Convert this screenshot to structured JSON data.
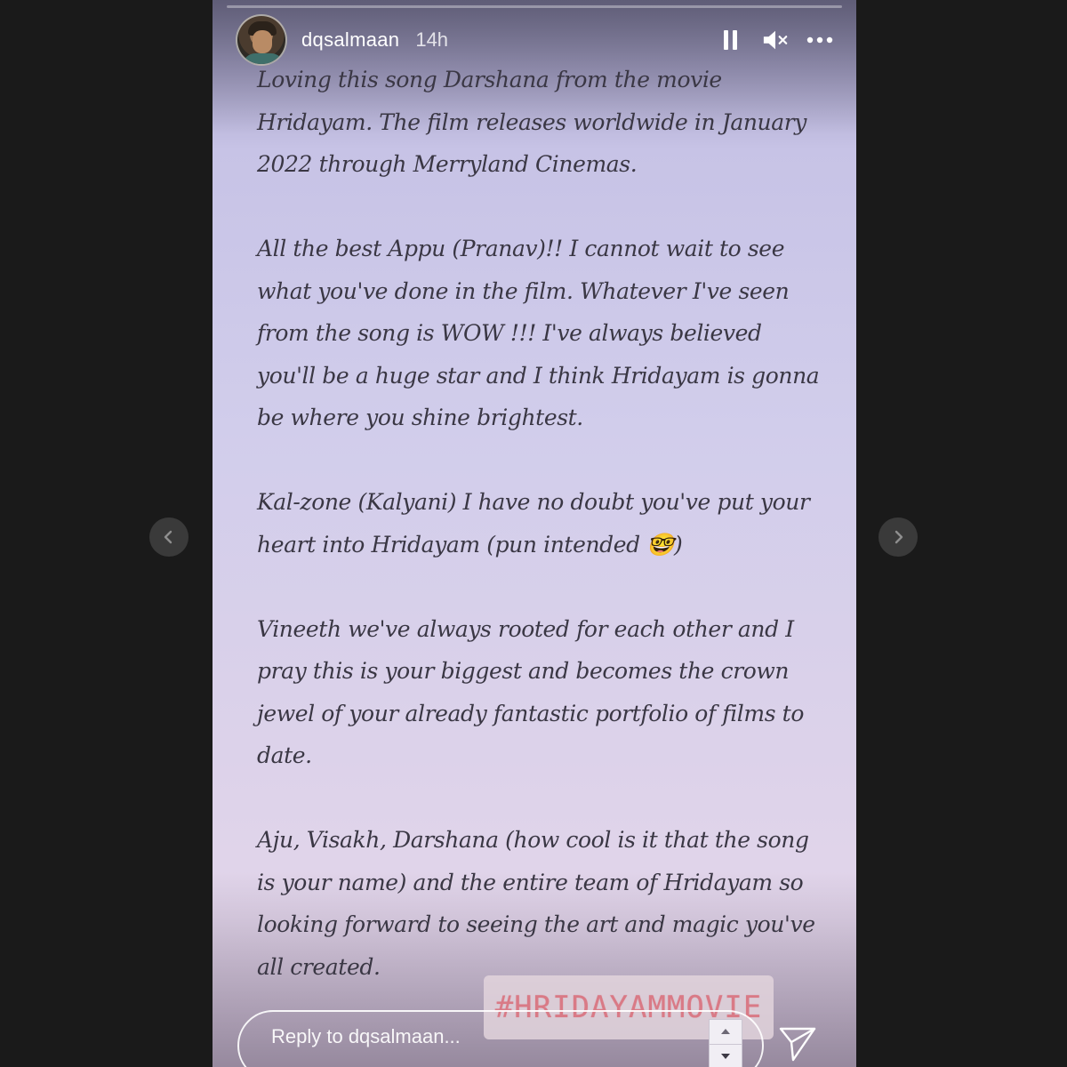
{
  "story": {
    "progress": 0.0,
    "username": "dqsalmaan",
    "time": "14h",
    "caption_paragraphs": [
      "Loving this song Darshana from the movie Hridayam. The film releases worldwide in January 2022 through Merryland Cinemas.",
      "All the best Appu (Pranav)!! I cannot wait to see what you've done in the film. Whatever I've seen from the song is WOW !!! I've always believed you'll be a huge star and I think Hridayam is gonna be where you shine brightest.",
      "Kal-zone (Kalyani) I have no doubt you've put your heart into Hridayam (pun intended 🤓)",
      "Vineeth we've always rooted for each other and I pray this is your biggest and becomes the crown jewel of your already fantastic portfolio of films to date.",
      "Aju, Visakh, Darshana (how cool is it that the song is your name) and the entire team of Hridayam so looking forward to seeing the art and magic you've all created."
    ],
    "hashtag": "#HRIDAYAMMOVIE"
  },
  "controls": {
    "pause_icon": "pause-icon",
    "mute_icon": "muted-speaker-icon",
    "more_icon": "more-options-icon"
  },
  "reply": {
    "placeholder": "Reply to dqsalmaan..."
  },
  "navigation": {
    "prev_icon": "chevron-left-icon",
    "next_icon": "chevron-right-icon"
  },
  "colors": {
    "page_background": "#1a1a1a",
    "caption_text": "#3a3744",
    "hashtag_text": "#d97a86",
    "nav_button": "#3a3a3a"
  }
}
